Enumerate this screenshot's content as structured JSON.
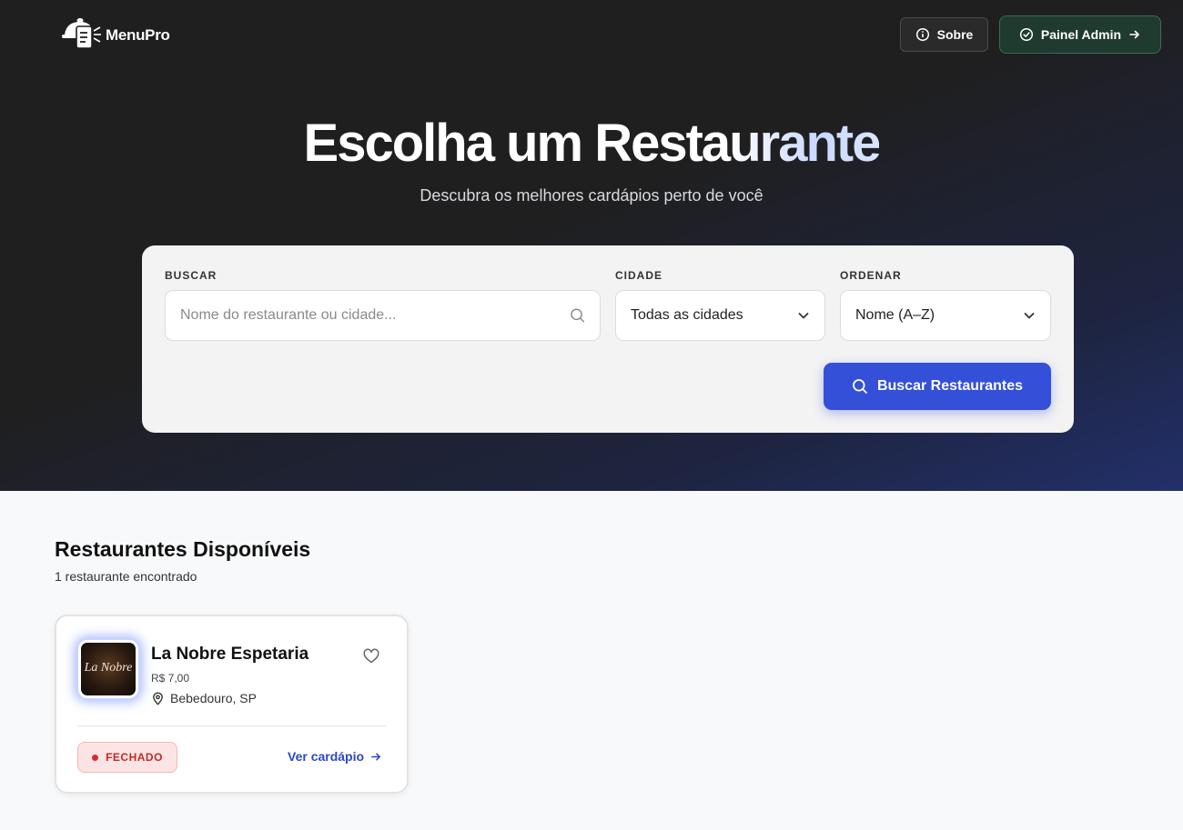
{
  "header": {
    "logo_text": "MenuPro",
    "about_label": "Sobre",
    "admin_label": "Painel Admin"
  },
  "hero": {
    "title_part1": "Escolha um Resta",
    "title_part2": "urante",
    "subtitle": "Descubra os melhores cardápios perto de você"
  },
  "search": {
    "search_label": "BUSCAR",
    "search_placeholder": "Nome do restaurante ou cidade...",
    "city_label": "CIDADE",
    "city_value": "Todas as cidades",
    "order_label": "ORDENAR",
    "order_value": "Nome (A–Z)",
    "button_label": "Buscar Restaurantes"
  },
  "results": {
    "title": "Restaurantes Disponíveis",
    "count": "1 restaurante encontrado",
    "items": [
      {
        "name": "La Nobre Espetaria",
        "price": "R$ 7,00",
        "location": "Bebedouro, SP",
        "status": "FECHADO",
        "link_label": "Ver cardápio",
        "thumb_text": "La Nobre"
      }
    ]
  },
  "colors": {
    "accent": "#3550d8",
    "admin_bg": "#1f3a2e",
    "closed_badge": "#fde4e4",
    "closed_text": "#c12a2a"
  }
}
